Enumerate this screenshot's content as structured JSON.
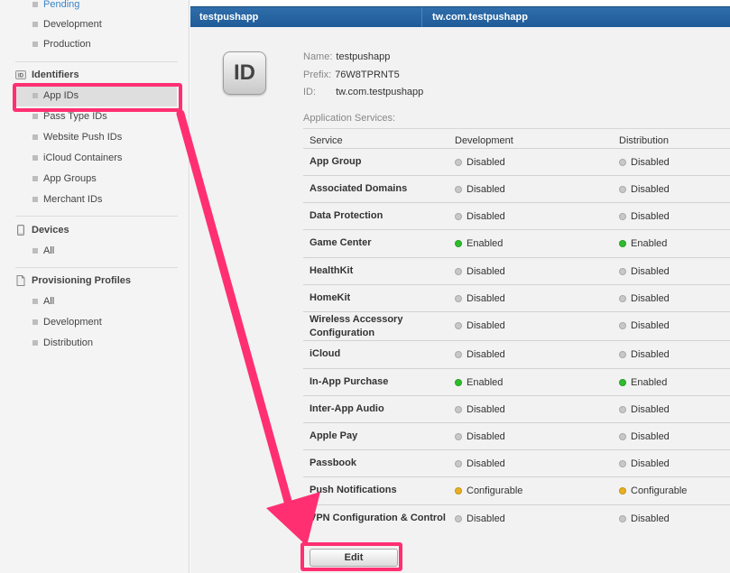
{
  "sidebar": {
    "top_items": [
      "Pending",
      "Development",
      "Production"
    ],
    "identifiers": {
      "header": "Identifiers",
      "icon": "id-badge-icon",
      "items": [
        "App IDs",
        "Pass Type IDs",
        "Website Push IDs",
        "iCloud Containers",
        "App Groups",
        "Merchant IDs"
      ],
      "selected": "App IDs"
    },
    "devices": {
      "header": "Devices",
      "icon": "device-icon",
      "items": [
        "All"
      ]
    },
    "profiles": {
      "header": "Provisioning Profiles",
      "icon": "document-icon",
      "items": [
        "All",
        "Development",
        "Distribution"
      ]
    }
  },
  "header": {
    "name": "testpushapp",
    "bundle_id": "tw.com.testpushapp",
    "bar_color": "#2466a4"
  },
  "app": {
    "icon_text": "ID",
    "name_label": "Name:",
    "name_value": "testpushapp",
    "prefix_label": "Prefix:",
    "prefix_value": "76W8TPRNT5",
    "id_label": "ID:",
    "id_value": "tw.com.testpushapp"
  },
  "services": {
    "title": "Application Services:",
    "columns": [
      "Service",
      "Development",
      "Distribution"
    ],
    "rows": [
      {
        "name": "App Group",
        "dev": "Disabled",
        "dist": "Disabled"
      },
      {
        "name": "Associated Domains",
        "dev": "Disabled",
        "dist": "Disabled"
      },
      {
        "name": "Data Protection",
        "dev": "Disabled",
        "dist": "Disabled"
      },
      {
        "name": "Game Center",
        "dev": "Enabled",
        "dist": "Enabled"
      },
      {
        "name": "HealthKit",
        "dev": "Disabled",
        "dist": "Disabled"
      },
      {
        "name": "HomeKit",
        "dev": "Disabled",
        "dist": "Disabled"
      },
      {
        "name": "Wireless Accessory\nConfiguration",
        "dev": "Disabled",
        "dist": "Disabled"
      },
      {
        "name": "iCloud",
        "dev": "Disabled",
        "dist": "Disabled"
      },
      {
        "name": "In-App Purchase",
        "dev": "Enabled",
        "dist": "Enabled"
      },
      {
        "name": "Inter-App Audio",
        "dev": "Disabled",
        "dist": "Disabled"
      },
      {
        "name": "Apple Pay",
        "dev": "Disabled",
        "dist": "Disabled"
      },
      {
        "name": "Passbook",
        "dev": "Disabled",
        "dist": "Disabled"
      },
      {
        "name": "Push Notifications",
        "dev": "Configurable",
        "dist": "Configurable"
      },
      {
        "name": "VPN Configuration & Control",
        "dev": "Disabled",
        "dist": "Disabled"
      }
    ],
    "status_colors": {
      "Enabled": "#2dbd2d",
      "Disabled": "#c8c8c8",
      "Configurable": "#e8b020"
    }
  },
  "actions": {
    "edit_label": "Edit"
  },
  "annotation": {
    "color": "#ff2f72"
  }
}
